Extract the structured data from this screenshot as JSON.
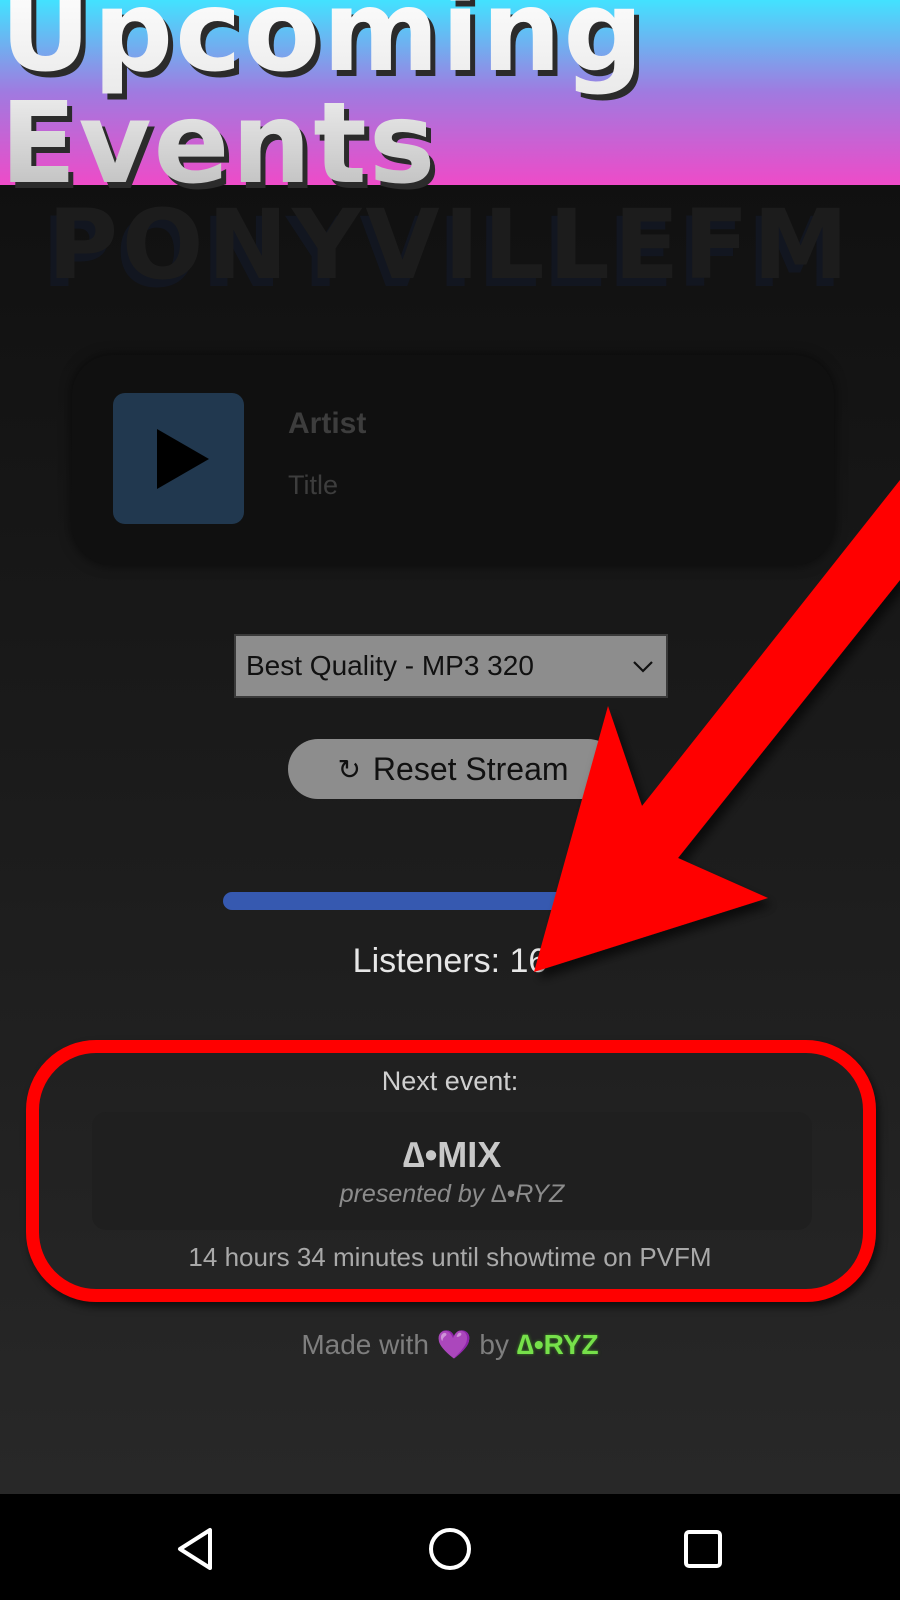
{
  "banner": {
    "title": "Upcoming Events"
  },
  "brand": {
    "logo_text": "PONYVILLEFM"
  },
  "player": {
    "artist": "Artist",
    "title": "Title",
    "play_icon": "play-icon"
  },
  "stream": {
    "quality_selected": "Best Quality - MP3 320",
    "reset_icon": "↻",
    "reset_label": "Reset Stream",
    "volume_fraction": 0.75
  },
  "stats": {
    "listeners": "Listeners: 16"
  },
  "event": {
    "label": "Next event:",
    "name": "∆•MIX",
    "presenter": "presented by ∆•RYZ",
    "countdown": "14 hours 34 minutes until showtime on PVFM"
  },
  "footer": {
    "prefix": "Made with",
    "heart": "💜",
    "by": "by",
    "author": "∆•RYZ"
  },
  "annotation": {
    "color": "#ff0000"
  },
  "nav": {
    "back_icon": "back-triangle-icon",
    "home_icon": "home-circle-icon",
    "recents_icon": "recents-square-icon"
  },
  "colors": {
    "accent": "#3659b0",
    "banner_top": "#42e2ff",
    "banner_bottom": "#ee4bc8",
    "author": "#76e04a"
  }
}
